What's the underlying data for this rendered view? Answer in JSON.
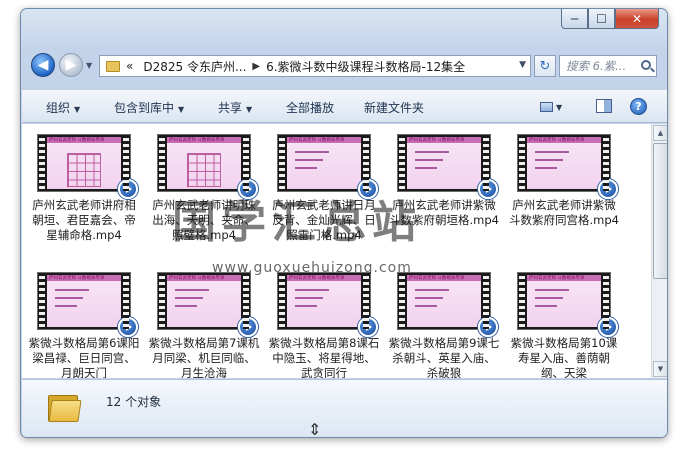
{
  "window": {
    "caption": {
      "minimize": "─",
      "maximize": "☐",
      "close": "✕"
    }
  },
  "address": {
    "back_glyph": "◀",
    "forward_glyph": "▶",
    "overflow": "«",
    "crumbs": [
      "D2825 令东庐州...",
      "6.紫微斗数中级课程斗数格局-12集全"
    ],
    "sep": "▶",
    "dropdown": "▼",
    "refresh_glyph": "↻",
    "search_placeholder": "搜索 6.紫..."
  },
  "toolbar": {
    "organize": "组织",
    "include_library": "包含到库中",
    "share": "共享",
    "play_all": "全部播放",
    "new_folder": "新建文件夹",
    "arrow": "▼",
    "help": "?"
  },
  "files": [
    {
      "name": "庐州玄武老师讲府相朝垣、君臣嘉会、帝星辅命格.mp4"
    },
    {
      "name": "庐州玄武老师讲明珠出海、天明、夹命、照璧格.mp4"
    },
    {
      "name": "庐州玄武老师讲日月反背、金灿光辉、日照雷门格.mp4"
    },
    {
      "name": "庐州玄武老师讲紫微斗数紫府朝垣格.mp4"
    },
    {
      "name": "庐州玄武老师讲紫微斗数紫府同宫格.mp4"
    },
    {
      "name": "紫微斗数格局第6课阳梁昌禄、巨日同宫、月朗天门"
    },
    {
      "name": "紫微斗数格局第7课机月同梁、机巨同临、月生沧海"
    },
    {
      "name": "紫微斗数格局第8课石中隐玉、将星得地、武贪同行"
    },
    {
      "name": "紫微斗数格局第9课七杀朝斗、英星入庙、杀破狼"
    },
    {
      "name": "紫微斗数格局第10课寿星入庙、善荫朝纲、天梁"
    }
  ],
  "thumb_title": "庐州玄武老师 斗数格局传承",
  "watermark": {
    "text": "国学汇总站",
    "url": "www.guoxuehuizong.com"
  },
  "details": {
    "count": "12 个对象"
  },
  "scrollbar": {
    "up": "▲",
    "down": "▼"
  },
  "cursor": "⇕"
}
